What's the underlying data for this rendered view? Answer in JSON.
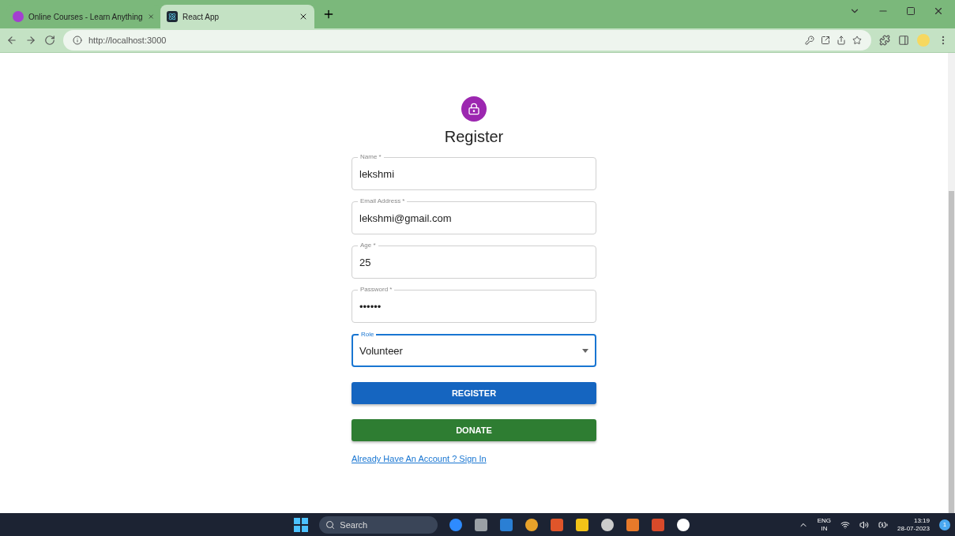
{
  "browser": {
    "tabs": [
      {
        "title": "Online Courses - Learn Anything",
        "selected": false
      },
      {
        "title": "React App",
        "selected": true
      }
    ],
    "url": "http://localhost:3000"
  },
  "form": {
    "title": "Register",
    "fields": [
      {
        "kind": "text",
        "label": "Name *",
        "value": "lekshmi",
        "focused": false
      },
      {
        "kind": "text",
        "label": "Email Address *",
        "value": "lekshmi@gmail.com",
        "focused": false
      },
      {
        "kind": "text",
        "label": "Age *",
        "value": "25",
        "focused": false
      },
      {
        "kind": "text",
        "label": "Password *",
        "value": "••••••",
        "focused": false
      },
      {
        "kind": "select",
        "label": "Role",
        "value": "Volunteer",
        "focused": true
      }
    ],
    "buttons": [
      {
        "label": "REGISTER",
        "color": "#1565c0"
      },
      {
        "label": "DONATE",
        "color": "#2e7d32"
      }
    ],
    "link": "Already Have An Account ? Sign In"
  },
  "taskbar": {
    "search_placeholder": "Search",
    "language": "ENG",
    "region": "IN",
    "time": "13:19",
    "date": "28-07-2023",
    "notifications": "1"
  }
}
